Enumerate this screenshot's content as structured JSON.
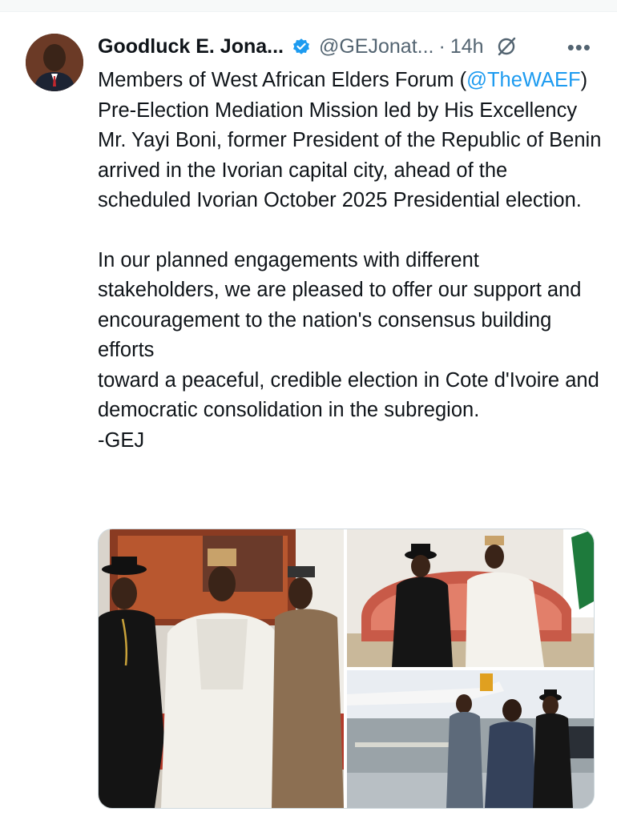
{
  "tweet": {
    "author_name": "Goodluck E. Jona...",
    "handle": "@GEJonat...",
    "separator": "·",
    "time": "14h",
    "verified_icon": "verified-badge-icon",
    "more_icon": "more-icon",
    "more_label": "•••",
    "grok_icon": "grok-icon",
    "accent_color": "#1d9bf0",
    "paragraph1": {
      "before_mention": "Members of West African Elders Forum (",
      "mention": "@TheWAEF",
      "after_mention": ") Pre-Election Mediation Mission led by His Excellency Mr. Yayi Boni, former President of the Republic of Benin arrived in the Ivorian capital city, ahead of the scheduled Ivorian October 2025 Presidential election."
    },
    "paragraph2_line1": "In our planned engagements with different stakeholders, we are pleased to offer our support and encouragement to the nation's consensus building efforts",
    "paragraph2_line2": "toward a peaceful, credible election in Cote d'Ivoire and democratic consolidation in the subregion.",
    "signature": "-GEJ"
  },
  "media": {
    "photos": [
      {
        "name": "three-men-standing-photo"
      },
      {
        "name": "two-men-seated-photo"
      },
      {
        "name": "airport-tarmac-photo"
      }
    ]
  }
}
